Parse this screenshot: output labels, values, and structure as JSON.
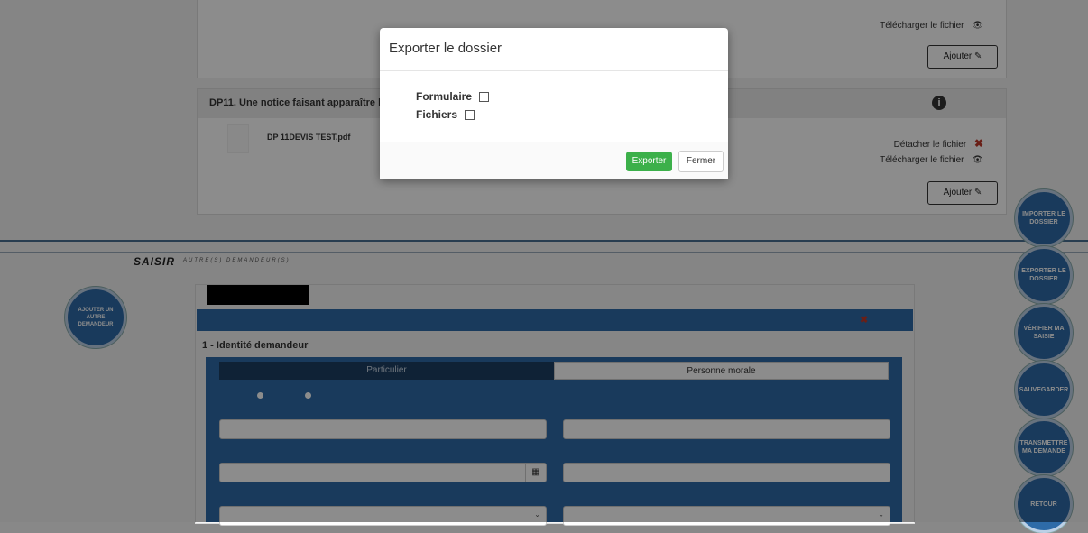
{
  "files_section_top": {
    "download_label": "Télécharger le fichier",
    "add_label": "Ajouter"
  },
  "dp11": {
    "title": "DP11. Une notice faisant apparaître le",
    "file_name": "DP 11DEVIS TEST.pdf",
    "detach_label": "Détacher le fichier",
    "download_label": "Télécharger le fichier",
    "add_label": "Ajouter"
  },
  "section": {
    "title": "SAISIR",
    "subtitle": "AUTRE(S) DEMANDEUR(S)"
  },
  "add_requester_button": "AJOUTER UN AUTRE DEMANDEUR",
  "form": {
    "section_title": "1 - Identité demandeur",
    "tab_particulier": "Particulier",
    "tab_personne_morale": "Personne morale"
  },
  "side_actions": [
    "IMPORTER LE DOSSIER",
    "EXPORTER LE DOSSIER",
    "VÉRIFIER MA SAISIE",
    "SAUVEGARDER",
    "TRANSMETTRE MA DEMANDE",
    "RETOUR"
  ],
  "modal": {
    "title": "Exporter le dossier",
    "option_form": "Formulaire",
    "option_files": "Fichiers",
    "export_button": "Exporter",
    "close_button": "Fermer"
  },
  "colors": {
    "primary_blue": "#2e6ba8",
    "dark_blue": "#1d3f63",
    "export_green": "#3cb04a"
  }
}
